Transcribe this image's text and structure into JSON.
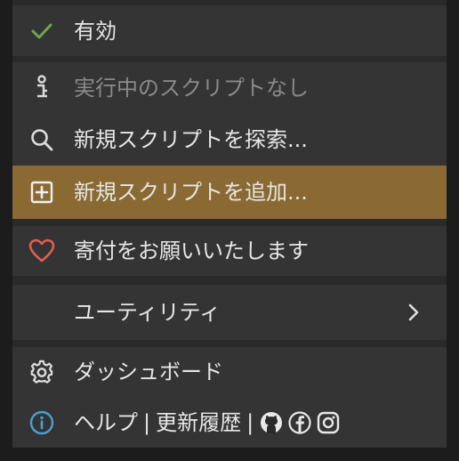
{
  "menu": {
    "enabled": {
      "label": "有効",
      "icon": "checkmark-icon",
      "color": "#6aa84f"
    },
    "scripts_status": {
      "label": "実行中のスクリプトなし",
      "icon": "info-lock-icon"
    },
    "find_scripts": {
      "label": "新規スクリプトを探索...",
      "icon": "search-icon"
    },
    "add_script": {
      "label": "新規スクリプトを追加...",
      "icon": "plus-square-icon",
      "highlight": "#8a6a32"
    },
    "donate": {
      "label": "寄付をお願いいたします",
      "icon": "heart-icon",
      "color": "#e06050"
    },
    "utilities": {
      "label": "ユーティリティ",
      "icon": "chevron-right-icon"
    },
    "dashboard": {
      "label": "ダッシュボード",
      "icon": "gear-icon"
    },
    "footer": {
      "icon": "info-circle-icon",
      "help_label": "ヘルプ",
      "separator": "|",
      "changelog_label": "更新履歴",
      "social_icons": [
        "github-icon",
        "facebook-icon",
        "instagram-icon"
      ]
    }
  }
}
